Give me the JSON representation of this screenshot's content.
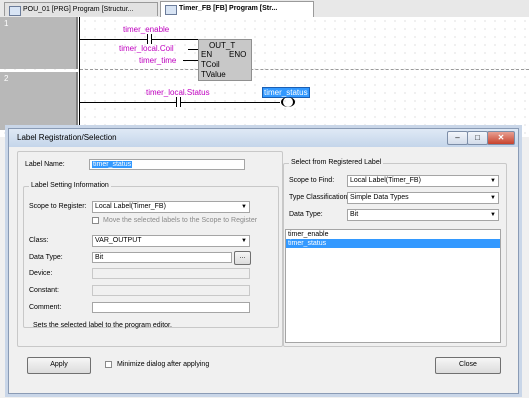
{
  "tabs": [
    {
      "label": "POU_01 [PRG] Program [Structur...",
      "active": false
    },
    {
      "label": "Timer_FB [FB] Program [Str...",
      "active": true
    }
  ],
  "editor": {
    "rows": [
      {
        "number": "1"
      },
      {
        "number": "2"
      }
    ],
    "row1": {
      "fb_name": "OUT_T",
      "en": "EN",
      "eno": "ENO",
      "tcoil": "TCoil",
      "tvalue": "TValue",
      "inputs": [
        "timer_enable",
        "timer_local.Coil",
        "timer_time"
      ]
    },
    "row2": {
      "contact": "timer_local.Status",
      "coil": "timer_status"
    }
  },
  "dialog": {
    "title": "Label Registration/Selection",
    "label_name_label": "Label Name:",
    "label_name_value": "timer_status",
    "setting_group": "Label Setting Information",
    "scope_register_label": "Scope to Register:",
    "scope_register_value": "Local Label(Timer_FB)",
    "move_label": "Move the selected labels to the Scope to Register",
    "class_label": "Class:",
    "class_value": "VAR_OUTPUT",
    "data_type_label": "Data Type:",
    "data_type_value": "Bit",
    "browse_label": "...",
    "device_label": "Device:",
    "constant_label": "Constant:",
    "comment_label": "Comment:",
    "status_text": "Sets the selected label to the program editor.",
    "select_group": "Select from Registered Label",
    "scope_find_label": "Scope to Find:",
    "scope_find_value": "Local Label(Timer_FB)",
    "type_class_label": "Type Classification:",
    "type_class_value": "Simple Data Types",
    "data_type2_label": "Data Type:",
    "data_type2_value": "Bit",
    "labels": [
      "timer_enable",
      "timer_status"
    ],
    "selected_label_index": 1,
    "apply_label": "Apply",
    "minimize_label": "Minimize dialog after applying",
    "close_label": "Close",
    "min_glyph": "–",
    "max_glyph": "□",
    "close_glyph": "✕",
    "arrow_glyph": "▼"
  },
  "colors": {
    "variable": "#c000c0",
    "selection": "#3399ff"
  }
}
